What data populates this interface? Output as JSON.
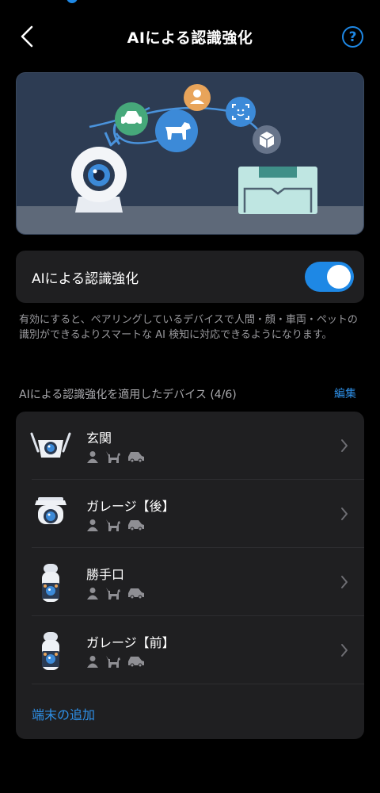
{
  "header": {
    "title": "AIによる認識強化",
    "back_icon": "chevron-left-icon",
    "help_label": "?"
  },
  "hero": {
    "illustration": "camera-with-recognized-objects",
    "icons": [
      "camera-icon",
      "vehicle-icon",
      "pet-icon",
      "person-icon",
      "face-scan-icon",
      "package-icon",
      "home-hub-icon"
    ]
  },
  "toggle": {
    "label": "AIによる認識強化",
    "enabled": true
  },
  "description": "有効にすると、ペアリングしているデバイスで人間・顔・車両・ペットの識別ができるよりスマートな AI 検知に対応できるようになります。",
  "devices_section": {
    "title": "AIによる認識強化を適用したデバイス (4/6)",
    "edit_label": "編集",
    "devices": [
      {
        "name": "玄関",
        "camera": "outdoor-camera-antennas",
        "detections": [
          "person-icon",
          "pet-icon",
          "vehicle-icon"
        ]
      },
      {
        "name": "ガレージ【後】",
        "camera": "pan-tilt-outdoor-camera",
        "detections": [
          "person-icon",
          "pet-icon",
          "vehicle-icon"
        ]
      },
      {
        "name": "勝手口",
        "camera": "bullet-camera",
        "detections": [
          "person-icon",
          "pet-icon",
          "vehicle-icon"
        ]
      },
      {
        "name": "ガレージ【前】",
        "camera": "bullet-camera",
        "detections": [
          "person-icon",
          "pet-icon",
          "vehicle-icon"
        ]
      }
    ],
    "add_label": "端末の追加"
  },
  "colors": {
    "accent": "#1e88e5",
    "background": "#000000",
    "card": "#1f1f21",
    "secondary_text": "#9a9a9e"
  }
}
